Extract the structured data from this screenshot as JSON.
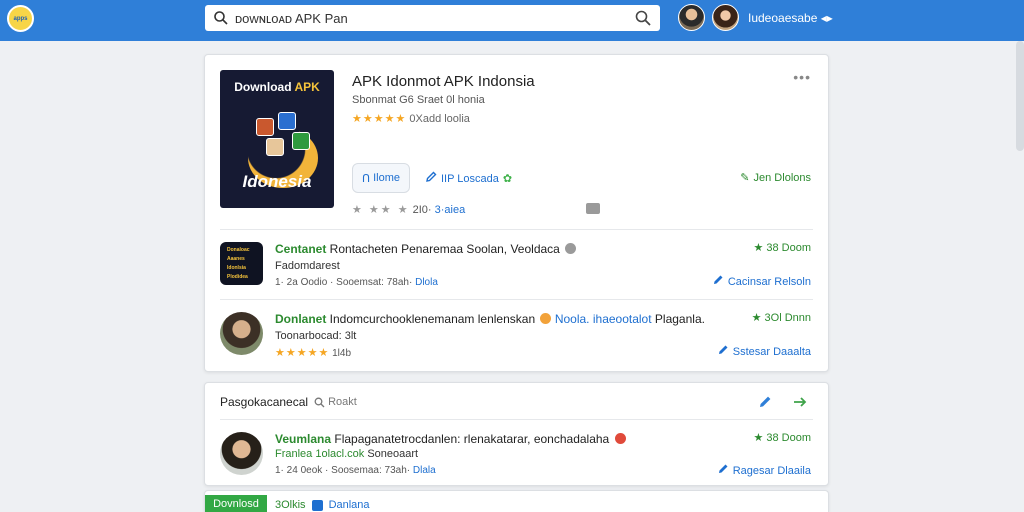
{
  "header": {
    "logo_text": "apps",
    "search_value": "ᴅᴏᴡɴʟᴏᴀᴅ APK Pan",
    "user_name": "Iudeoaesabe"
  },
  "colors": {
    "primary": "#2f7fd8",
    "green": "#2c8a2f",
    "star": "#f5a623",
    "link": "#1e6fd0"
  },
  "app": {
    "image_top": "Download",
    "image_top_accent": "APK",
    "image_bottom": "Idonesia",
    "title": "APK Idonmot APK Indonsia",
    "subtitle": "Sbonmat  G6 Sraet 0l honia",
    "stars": "★★★★★",
    "rating_text": "0Xadd loolia",
    "more": "•••",
    "home_button": "Ilome",
    "download_link": "IIP Loscada",
    "right_link": "Jen Dlolons",
    "row_stars": "★ ★★ ★",
    "row_count": "2I0·",
    "row_label": "3·aiea"
  },
  "items": [
    {
      "title_green": "Centanet",
      "title": " Rontacheten Penaremaa Soolan, Veoldaca",
      "sub": "Fadomdarest",
      "meta": "1· 2a  Oodio · Sooemsat: 78ah·",
      "meta_blue": "Dlola",
      "right_top": "★ 38 Doom",
      "right_bot": "Cacinsar Relsoln",
      "thumb_text": [
        "Donaloac",
        "Aaanes",
        "Idonlsia",
        "Plodidea"
      ]
    },
    {
      "title_green": "Donlanet",
      "title": " Indomcurchooklenemanam lenlenskan",
      "title_blue": " Noola. ihaeootalot",
      "title_end": " Plaganla.",
      "sub": "Toonarbocad: 3lt",
      "stars": "★★★★★",
      "meta": "1l4b",
      "right_top": "★ 3Ol Dnnn",
      "right_bot": "Sstesar Daaalta"
    }
  ],
  "section": {
    "title": "Pasgokacanecal",
    "query": "Roakt",
    "item": {
      "title_green": "Veumlana",
      "title": " Flapaganatetrocdanlen: rlenakatarar, eonchadalaha",
      "sub_green": "Franlea  1olacl.cok",
      "sub": "  Soneoaart",
      "meta": "1· 24  0eok · Soosemaa: 73ah·",
      "meta_blue": "Dlala",
      "right_top": "★ 38 Doom",
      "right_bot": "Ragesar Dlaaila"
    }
  },
  "footer": {
    "tab_label": "Dovnlosd",
    "count": "3Olkis",
    "label": "Danlana"
  }
}
